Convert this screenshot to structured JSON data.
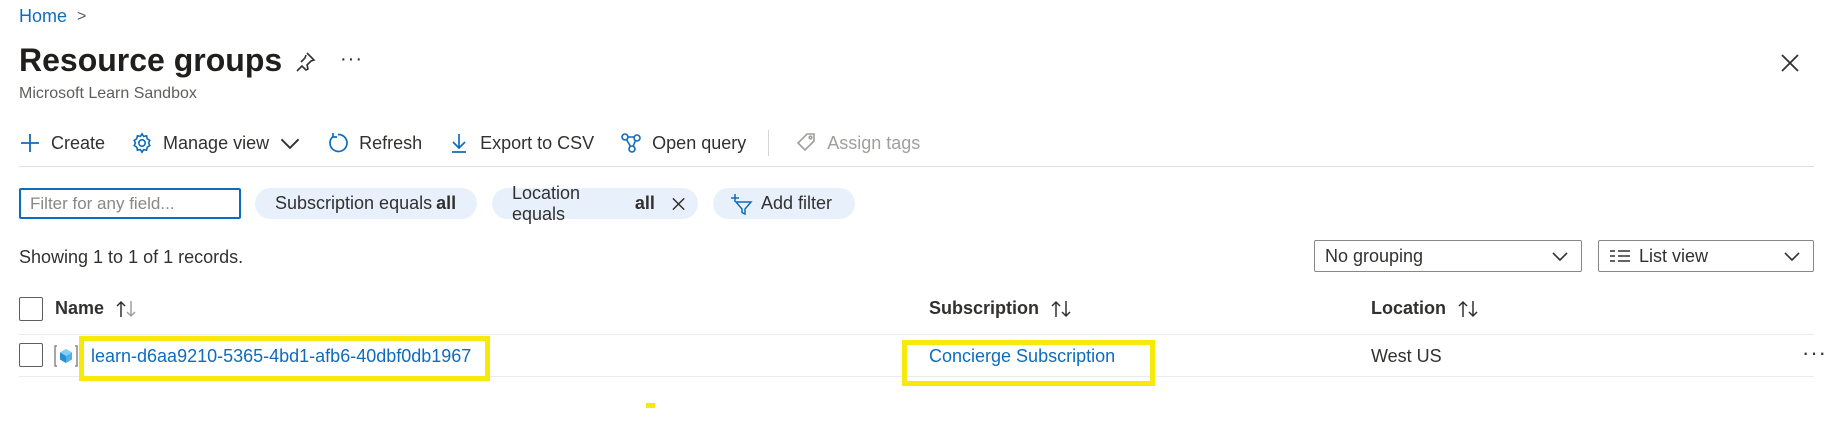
{
  "breadcrumb": {
    "home": "Home",
    "separator": ">"
  },
  "header": {
    "title": "Resource groups",
    "subtitle": "Microsoft Learn Sandbox",
    "more": "···"
  },
  "toolbar": {
    "create": "Create",
    "manage_view": "Manage view",
    "refresh": "Refresh",
    "export_csv": "Export to CSV",
    "open_query": "Open query",
    "assign_tags": "Assign tags"
  },
  "filters": {
    "placeholder": "Filter for any field...",
    "subscription_label": "Subscription equals",
    "subscription_value": "all",
    "location_label": "Location equals",
    "location_value": "all",
    "add_filter": "Add filter"
  },
  "records_text": "Showing 1 to 1 of 1 records.",
  "grouping": {
    "selected": "No grouping"
  },
  "view": {
    "selected": "List view"
  },
  "table": {
    "columns": [
      "Name",
      "Subscription",
      "Location"
    ],
    "rows": [
      {
        "name": "learn-d6aa9210-5365-4bd1-afb6-40dbf0db1967",
        "subscription": "Concierge Subscription",
        "location": "West US",
        "more": "···"
      }
    ]
  },
  "colors": {
    "accent": "#0f6cbd",
    "pill_bg": "#e8f1fb",
    "highlight": "#f5ea0a"
  },
  "icons": [
    "chevron-right-icon",
    "pin-icon",
    "close-icon",
    "plus-icon",
    "gear-icon",
    "chevron-down-icon",
    "refresh-icon",
    "download-icon",
    "query-icon",
    "tag-icon",
    "filter-add-icon",
    "list-icon",
    "sort-icon",
    "resource-group-icon"
  ]
}
